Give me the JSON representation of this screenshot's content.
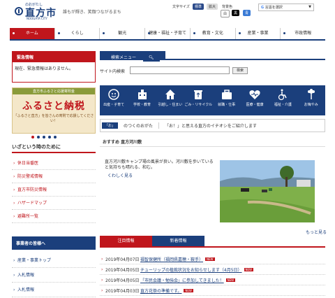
{
  "header": {
    "logo_small": "のおがたし",
    "logo_main": "直方市",
    "logo_en": "NOOGATA CITY",
    "tagline": "誰もが輝き、笑顔つながるまち",
    "font_size_label": "文字サイズ",
    "font_std": "標準",
    "font_large": "拡大",
    "bg_color_label": "背景色",
    "bg_white": "白",
    "bg_black": "黒",
    "bg_blue": "青",
    "translate_label": "言語を選択"
  },
  "nav": [
    {
      "label": "ホーム",
      "active": true
    },
    {
      "label": "くらし"
    },
    {
      "label": "観光"
    },
    {
      "label": "健康・福祉・子育て"
    },
    {
      "label": "教育・文化"
    },
    {
      "label": "産業・事業"
    },
    {
      "label": "市政情報"
    }
  ],
  "emergency": {
    "title": "緊急情報",
    "text": "現在、緊急情報はありません。"
  },
  "banner": {
    "top": "直方市ふるさと応援寄附金",
    "main": "ふるさと納税",
    "sub": "「ふるさと直方」を皆さんの寄附で応援してください！"
  },
  "emergency_section": {
    "title": "いざという時のために",
    "links": [
      "休日当番医",
      "防災警戒情報",
      "直方市防災情報",
      "ハザードマップ",
      "避難所一覧"
    ]
  },
  "business": {
    "title": "事業者の皆様へ",
    "links": [
      "産業・事業トップ",
      "入札情報",
      "入札情報"
    ]
  },
  "search": {
    "menu_label": "検索メニュー",
    "site_label": "サイト内検索",
    "button": "検索",
    "placeholder": ""
  },
  "categories": [
    {
      "label": "出産・子育て",
      "icon": "baby-icon"
    },
    {
      "label": "学校・教育",
      "icon": "school-icon"
    },
    {
      "label": "引越し・住まい",
      "icon": "house-icon"
    },
    {
      "label": "ごみ・リサイクル",
      "icon": "recycle-icon"
    },
    {
      "label": "就職・仕事",
      "icon": "briefcase-icon"
    },
    {
      "label": "医療・健康",
      "icon": "heart-icon"
    },
    {
      "label": "福祉・介護",
      "icon": "wheelchair-icon"
    },
    {
      "label": "お悔やみ",
      "icon": "flower-icon"
    }
  ],
  "oshirase": {
    "tag": "「お」",
    "title": "のつくのおがた",
    "text": "「お！」と思える直方のイチオシをご紹介します"
  },
  "feature": {
    "head": "おすすめ 直方河川敷",
    "text": "直方河川敷キャンプ場の風景が良い。河川敷を歩いていると気持ちも晴れる、和む。",
    "link": "くわしく見る"
  },
  "more": "もっと見る",
  "news_tabs": [
    "注目情報",
    "新着情報"
  ],
  "news": [
    {
      "date": "2019年04月07日",
      "title": "福智保健所（福岡県嘉穂・鞍手）",
      "new": "NEW"
    },
    {
      "date": "2019年04月05日",
      "title": "チューリップの植栽状況をお知らせします（4月5日）",
      "new": "NEW"
    },
    {
      "date": "2019年04月05日",
      "title": "「市民会議・勉強会」に参加してきました！",
      "new": "NEW"
    },
    {
      "date": "2019年04月03日",
      "title": "直方花祭の準備です。",
      "new": "NEW"
    }
  ],
  "colors": {
    "navy": "#1b3f7c",
    "red": "#c0161c"
  }
}
